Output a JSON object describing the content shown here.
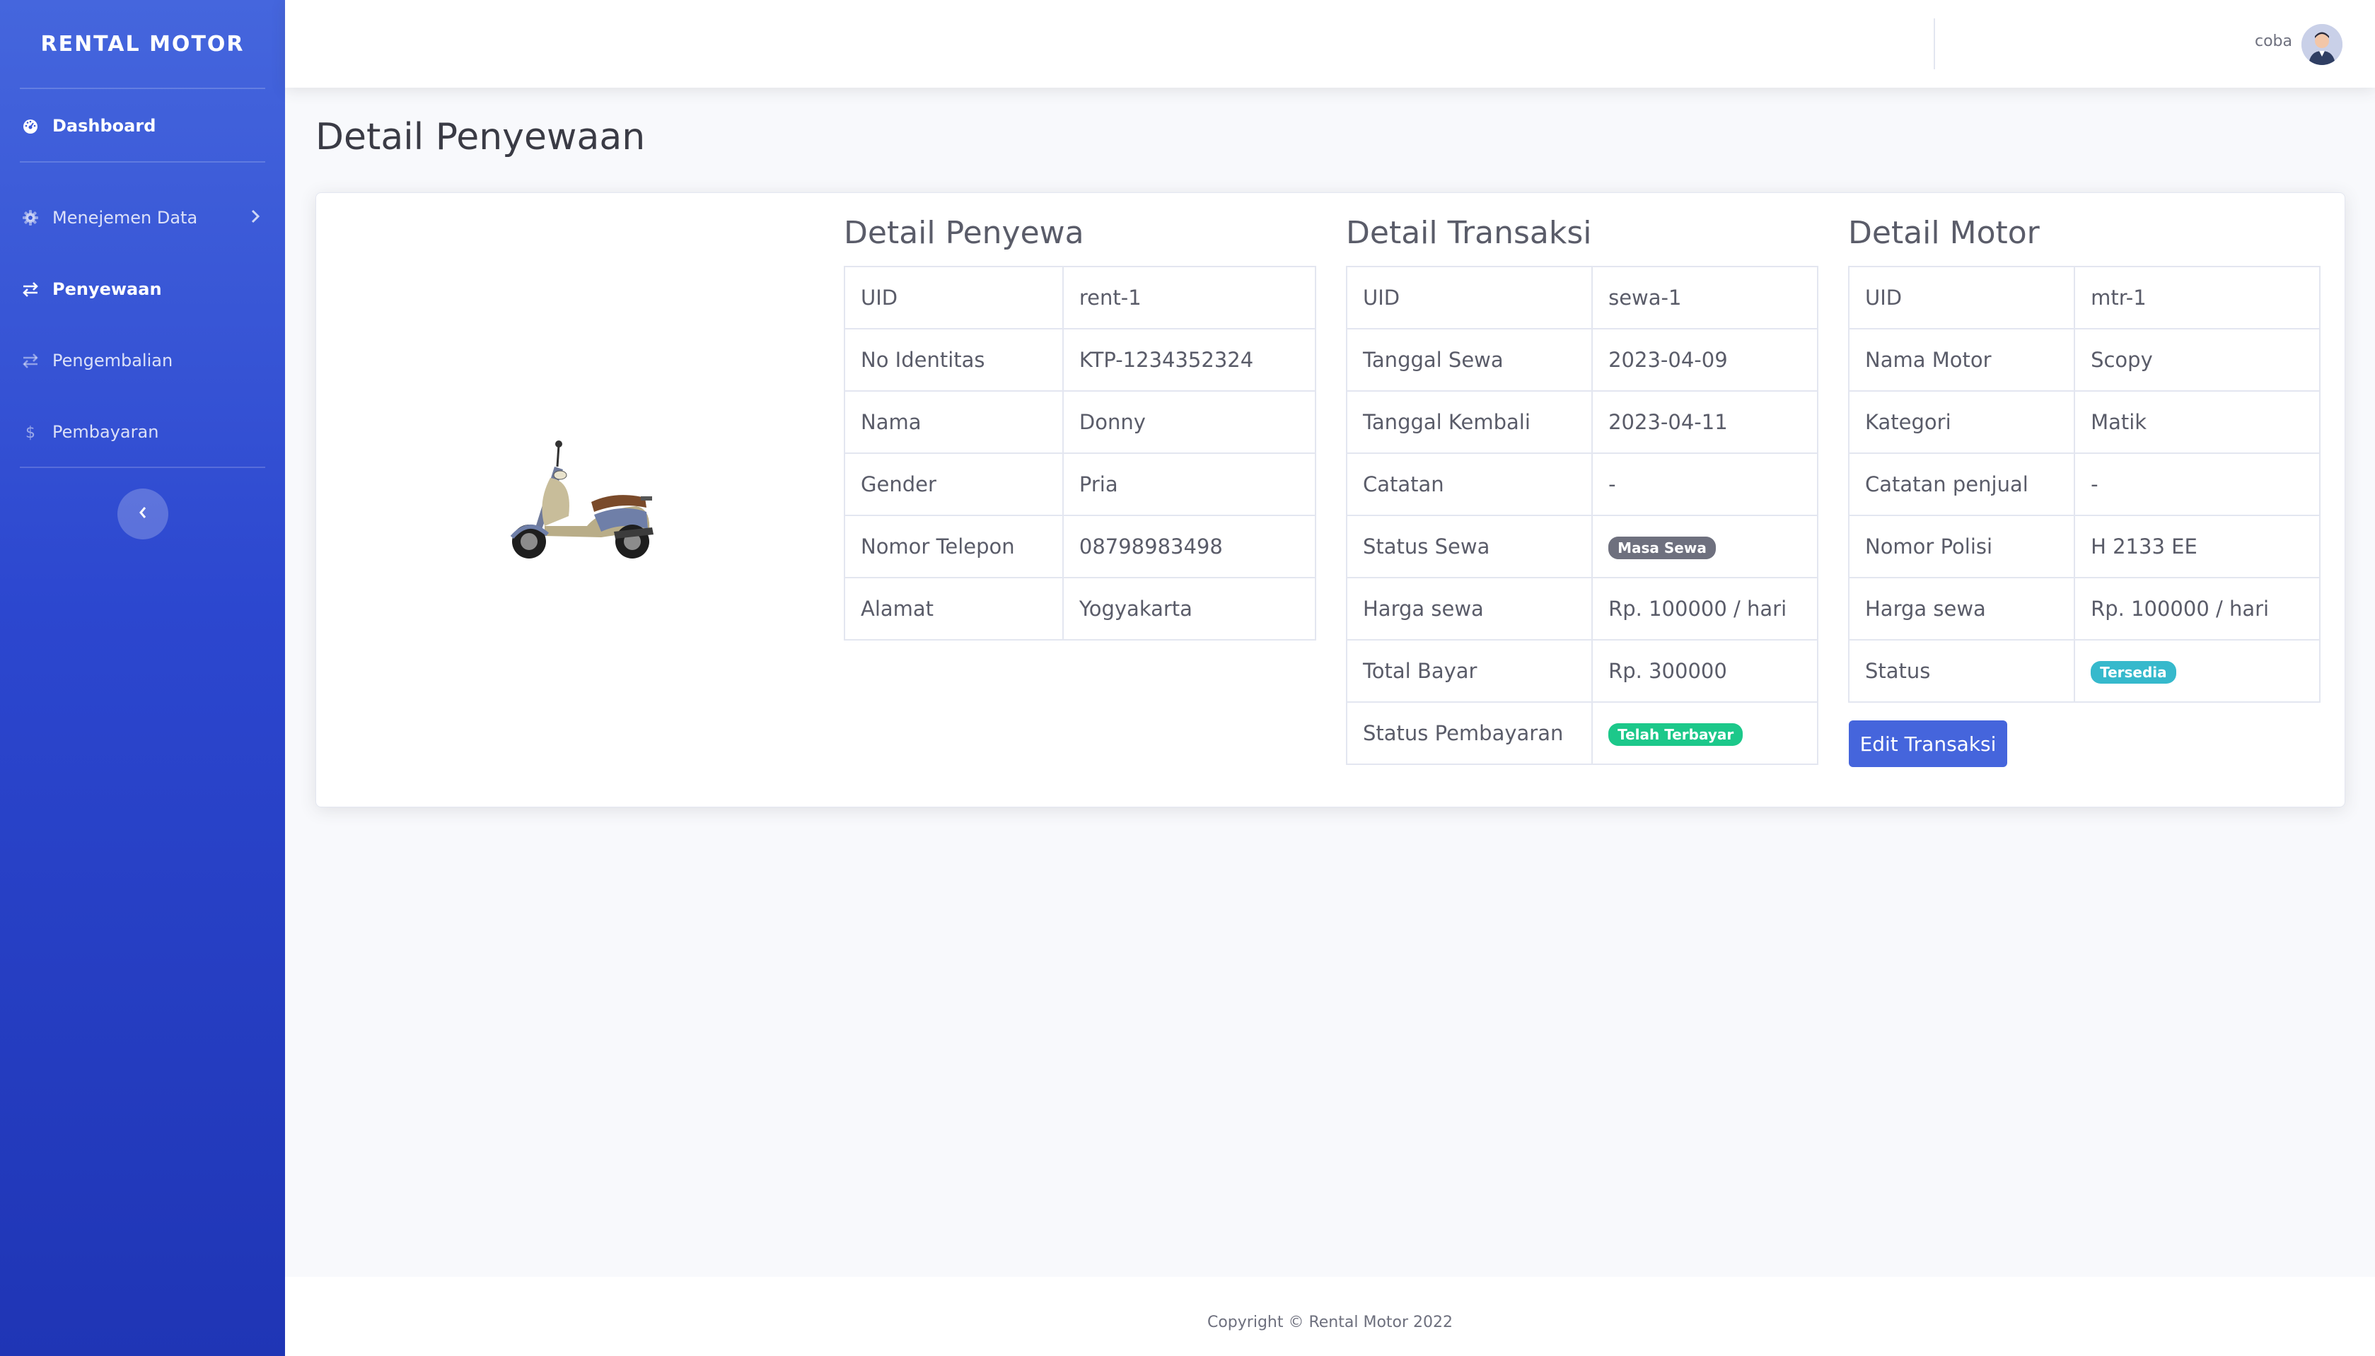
{
  "sidebar": {
    "brand": "RENTAL MOTOR",
    "items": [
      {
        "label": "Dashboard",
        "icon": "dashboard-gauge-icon"
      },
      {
        "label": "Menejemen Data",
        "icon": "gear-icon"
      },
      {
        "label": "Penyewaan",
        "icon": "exchange-arrows-icon"
      },
      {
        "label": "Pengembalian",
        "icon": "exchange-arrows-icon"
      },
      {
        "label": "Pembayaran",
        "icon": "dollar-icon"
      }
    ]
  },
  "topbar": {
    "username": "coba"
  },
  "page": {
    "title": "Detail Penyewaan"
  },
  "penyewa": {
    "title": "Detail Penyewa",
    "rows": [
      {
        "label": "UID",
        "value": "rent-1"
      },
      {
        "label": "No Identitas",
        "value": "KTP-1234352324"
      },
      {
        "label": "Nama",
        "value": "Donny"
      },
      {
        "label": "Gender",
        "value": "Pria"
      },
      {
        "label": "Nomor Telepon",
        "value": "08798983498"
      },
      {
        "label": "Alamat",
        "value": "Yogyakarta"
      }
    ]
  },
  "transaksi": {
    "title": "Detail Transaksi",
    "rows": [
      {
        "label": "UID",
        "value": "sewa-1"
      },
      {
        "label": "Tanggal Sewa",
        "value": "2023-04-09"
      },
      {
        "label": "Tanggal Kembali",
        "value": "2023-04-11"
      },
      {
        "label": "Catatan",
        "value": "-"
      },
      {
        "label": "Status Sewa",
        "value": "Masa Sewa"
      },
      {
        "label": "Harga sewa",
        "value": "Rp. 100000 / hari"
      },
      {
        "label": "Total Bayar",
        "value": "Rp. 300000"
      },
      {
        "label": "Status Pembayaran",
        "value": "Telah Terbayar"
      }
    ]
  },
  "motor": {
    "title": "Detail Motor",
    "rows": [
      {
        "label": "UID",
        "value": "mtr-1"
      },
      {
        "label": "Nama Motor",
        "value": "Scopy"
      },
      {
        "label": "Kategori",
        "value": "Matik"
      },
      {
        "label": "Catatan penjual",
        "value": "-"
      },
      {
        "label": "Nomor Polisi",
        "value": "H 2133 EE"
      },
      {
        "label": "Harga sewa",
        "value": "Rp. 100000 / hari"
      },
      {
        "label": "Status",
        "value": "Tersedia"
      }
    ],
    "edit_button": "Edit Transaksi"
  },
  "footer": {
    "copyright": "Copyright © Rental Motor 2022"
  },
  "colors": {
    "primary": "#4e73df",
    "success": "#1cc88a",
    "info": "#36b9cc",
    "secondary": "#6e707e"
  }
}
